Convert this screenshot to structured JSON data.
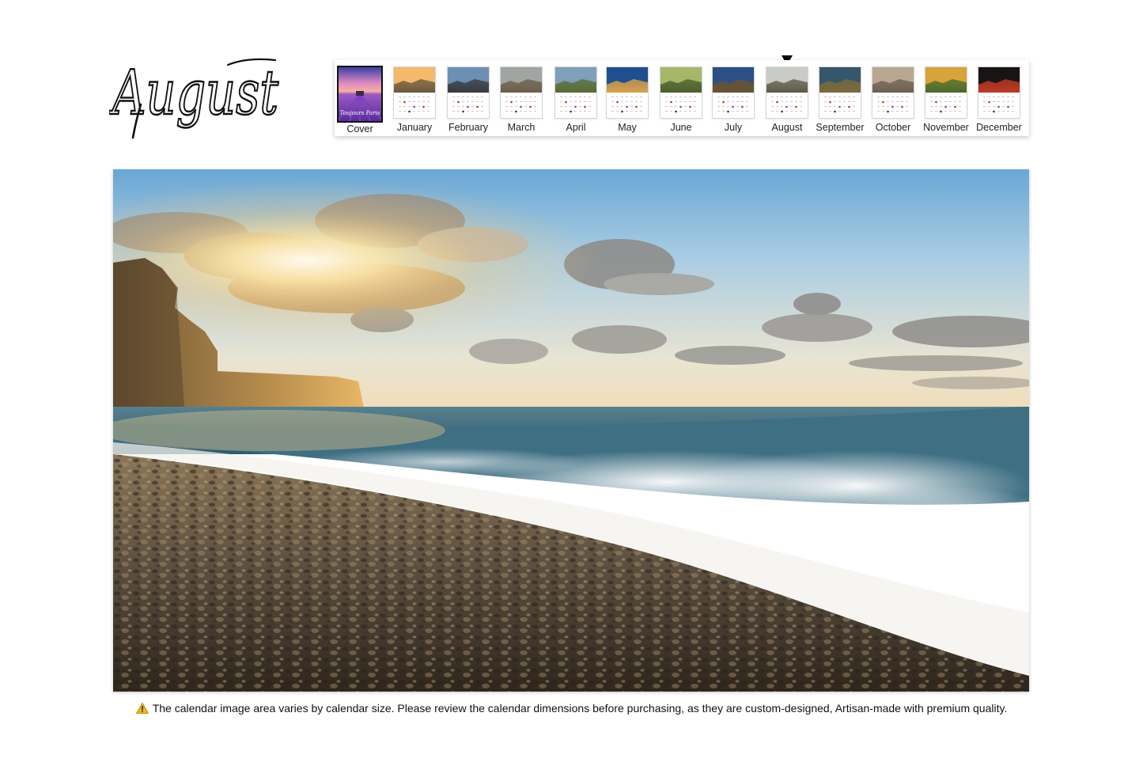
{
  "month_title": "August",
  "strip": {
    "selected": "August",
    "items": [
      {
        "label": "Cover",
        "cover": true,
        "cover_text": "Toujours Paris"
      },
      {
        "label": "January",
        "sky": "#f4b96b",
        "ground": "#6c5a3e"
      },
      {
        "label": "February",
        "sky": "#6d8fb3",
        "ground": "#3a3a3f"
      },
      {
        "label": "March",
        "sky": "#9fa6a1",
        "ground": "#6b5e4b"
      },
      {
        "label": "April",
        "sky": "#7ea0b8",
        "ground": "#5a6a34"
      },
      {
        "label": "May",
        "sky": "#1f4f8f",
        "ground": "#d9a24a"
      },
      {
        "label": "June",
        "sky": "#a5b86a",
        "ground": "#4c5e2c"
      },
      {
        "label": "July",
        "sky": "#2c4f86",
        "ground": "#6a5232"
      },
      {
        "label": "August",
        "sky": "#c9ccc6",
        "ground": "#5e5a4a"
      },
      {
        "label": "September",
        "sky": "#34576b",
        "ground": "#7d6a3c"
      },
      {
        "label": "October",
        "sky": "#b9a791",
        "ground": "#6c6052"
      },
      {
        "label": "November",
        "sky": "#d8a338",
        "ground": "#4a6a2c"
      },
      {
        "label": "December",
        "sky": "#171413",
        "ground": "#c23b25"
      }
    ]
  },
  "hero": {
    "subject": "sunset-beach-photo",
    "colors": {
      "sky_top": "#6aa7d4",
      "sun": "#fff3cf",
      "sea": "#3d6f86",
      "pebbles": "#5a4d3e",
      "cliff": "#c79a54"
    }
  },
  "footer_note": "The calendar image area varies by calendar size. Please review the calendar dimensions before purchasing, as they are custom-designed, Artisan-made with premium quality."
}
